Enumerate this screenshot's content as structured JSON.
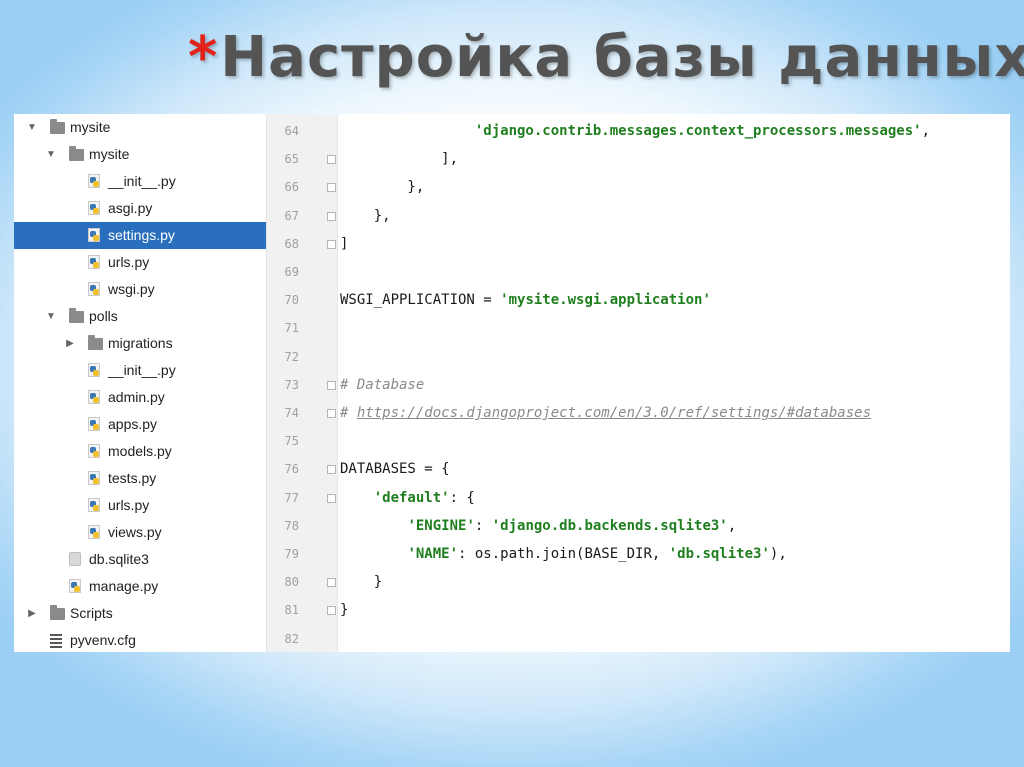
{
  "slide": {
    "title_star": "*",
    "title": "Настройка базы данных"
  },
  "project_tree": {
    "items": [
      {
        "label": "mysite",
        "type": "folder",
        "expanded": true,
        "indent": 0
      },
      {
        "label": "mysite",
        "type": "folder",
        "expanded": true,
        "indent": 1
      },
      {
        "label": "__init__.py",
        "type": "py",
        "indent": 2
      },
      {
        "label": "asgi.py",
        "type": "py",
        "indent": 2
      },
      {
        "label": "settings.py",
        "type": "py",
        "indent": 2,
        "selected": true
      },
      {
        "label": "urls.py",
        "type": "py",
        "indent": 2
      },
      {
        "label": "wsgi.py",
        "type": "py",
        "indent": 2
      },
      {
        "label": "polls",
        "type": "folder",
        "expanded": true,
        "indent": 1
      },
      {
        "label": "migrations",
        "type": "folder",
        "expanded": false,
        "indent": 2
      },
      {
        "label": "__init__.py",
        "type": "py",
        "indent": 2
      },
      {
        "label": "admin.py",
        "type": "py",
        "indent": 2
      },
      {
        "label": "apps.py",
        "type": "py",
        "indent": 2
      },
      {
        "label": "models.py",
        "type": "py",
        "indent": 2
      },
      {
        "label": "tests.py",
        "type": "py",
        "indent": 2
      },
      {
        "label": "urls.py",
        "type": "py",
        "indent": 2
      },
      {
        "label": "views.py",
        "type": "py",
        "indent": 2
      },
      {
        "label": "db.sqlite3",
        "type": "db",
        "indent": 1
      },
      {
        "label": "manage.py",
        "type": "py",
        "indent": 1
      },
      {
        "label": "Scripts",
        "type": "folder",
        "expanded": false,
        "indent": 0
      },
      {
        "label": "pyvenv.cfg",
        "type": "cfg",
        "indent": 0
      }
    ]
  },
  "editor": {
    "lines": [
      {
        "num": "64",
        "text": "                'django.contrib.messages.context_processors.messages',",
        "fold": false
      },
      {
        "num": "65",
        "text": "            ],",
        "fold": true
      },
      {
        "num": "66",
        "text": "        },",
        "fold": true
      },
      {
        "num": "67",
        "text": "    },",
        "fold": true
      },
      {
        "num": "68",
        "text": "]",
        "fold": true
      },
      {
        "num": "69",
        "text": "",
        "fold": false
      },
      {
        "num": "70",
        "text": "WSGI_APPLICATION = 'mysite.wsgi.application'",
        "fold": false
      },
      {
        "num": "71",
        "text": "",
        "fold": false
      },
      {
        "num": "72",
        "text": "",
        "fold": false
      },
      {
        "num": "73",
        "text": "# Database",
        "fold": true
      },
      {
        "num": "74",
        "text": "# https://docs.djangoproject.com/en/3.0/ref/settings/#databases",
        "fold": true
      },
      {
        "num": "75",
        "text": "",
        "fold": false
      },
      {
        "num": "76",
        "text": "DATABASES = {",
        "fold": true
      },
      {
        "num": "77",
        "text": "    'default': {",
        "fold": true
      },
      {
        "num": "78",
        "text": "        'ENGINE': 'django.db.backends.sqlite3',",
        "fold": false
      },
      {
        "num": "79",
        "text": "        'NAME': os.path.join(BASE_DIR, 'db.sqlite3'),",
        "fold": false
      },
      {
        "num": "80",
        "text": "    }",
        "fold": true
      },
      {
        "num": "81",
        "text": "}",
        "fold": true
      },
      {
        "num": "82",
        "text": "",
        "fold": false
      }
    ]
  },
  "colors": {
    "selection": "#2a6fbe",
    "string": "#1f7f1f",
    "comment": "#8a8a8a",
    "title_star": "#e2231a"
  }
}
